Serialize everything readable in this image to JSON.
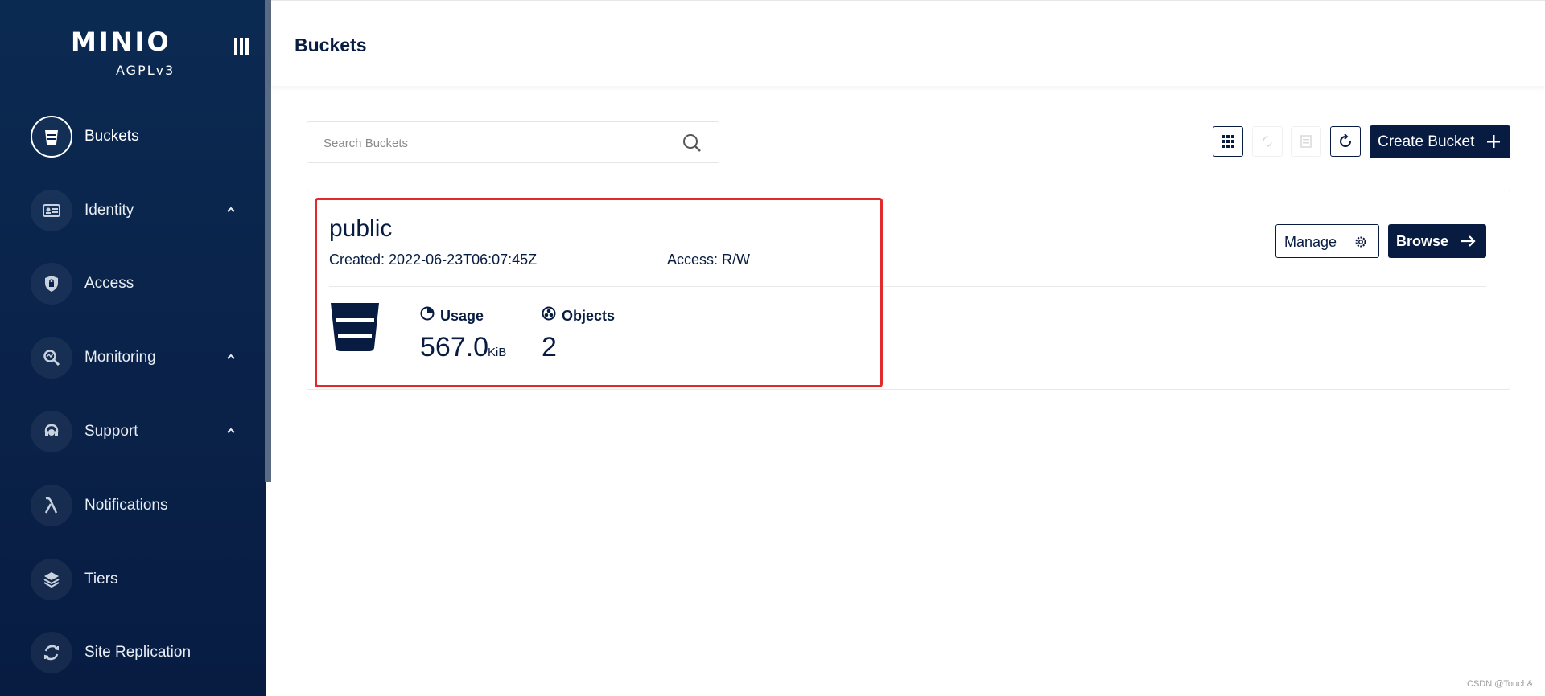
{
  "sidebar": {
    "logo_text": "MINIO",
    "license": "AGPLv3",
    "items": [
      {
        "label": "Buckets",
        "icon": "bucket-icon",
        "expandable": false,
        "active": true
      },
      {
        "label": "Identity",
        "icon": "identity-card-icon",
        "expandable": true
      },
      {
        "label": "Access",
        "icon": "lock-shield-icon",
        "expandable": false
      },
      {
        "label": "Monitoring",
        "icon": "monitoring-search-icon",
        "expandable": true
      },
      {
        "label": "Support",
        "icon": "support-headset-icon",
        "expandable": true
      },
      {
        "label": "Notifications",
        "icon": "lambda-icon",
        "expandable": false
      },
      {
        "label": "Tiers",
        "icon": "layers-icon",
        "expandable": false
      },
      {
        "label": "Site Replication",
        "icon": "replication-icon",
        "expandable": false
      }
    ]
  },
  "header": {
    "title": "Buckets"
  },
  "toolbar": {
    "search_placeholder": "Search Buckets",
    "create_label": "Create Bucket"
  },
  "bucket": {
    "name": "public",
    "created": "Created: 2022-06-23T06:07:45Z",
    "access": "Access: R/W",
    "usage_label": "Usage",
    "usage_value": "567.0",
    "usage_unit": "KiB",
    "objects_label": "Objects",
    "objects_value": "2",
    "manage_label": "Manage",
    "browse_label": "Browse"
  },
  "colors": {
    "sidebar_bg": "#0a2249",
    "primary": "#081c42",
    "highlight": "#e32a2a"
  },
  "watermark": "CSDN @Touch&"
}
